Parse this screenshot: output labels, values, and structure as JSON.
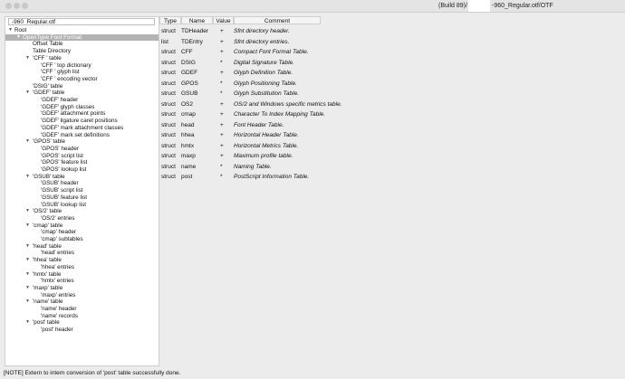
{
  "titlebar": {
    "build": "(Build 89)/",
    "path": "-960_Regular.otf/OTF"
  },
  "file_field": "-960_Regular.otf",
  "tree": [
    {
      "label": "Root",
      "arrow": "▼",
      "indent": 0
    },
    {
      "label": "OpenType Font Format",
      "arrow": "▼",
      "indent": 1,
      "selected": true
    },
    {
      "label": "Offset Table",
      "indent": 2
    },
    {
      "label": "Table Directory",
      "indent": 2
    },
    {
      "label": "'CFF ' table",
      "arrow": "▼",
      "indent": 2
    },
    {
      "label": "'CFF ' top dictionary",
      "indent": 3
    },
    {
      "label": "'CFF ' glyph list",
      "indent": 3
    },
    {
      "label": "'CFF ' encoding vector",
      "indent": 3
    },
    {
      "label": "'DSIG' table",
      "indent": 2
    },
    {
      "label": "'GDEF' table",
      "arrow": "▼",
      "indent": 2
    },
    {
      "label": "'GDEF' header",
      "indent": 3
    },
    {
      "label": "'GDEF' glyph classes",
      "indent": 3
    },
    {
      "label": "'GDEF' attachment points",
      "indent": 3
    },
    {
      "label": "'GDEF' ligature caret positions",
      "indent": 3
    },
    {
      "label": "'GDEF' mark attachment classes",
      "indent": 3
    },
    {
      "label": "'GDEF' mark set definitions",
      "indent": 3
    },
    {
      "label": "'GPOS' table",
      "arrow": "▼",
      "indent": 2
    },
    {
      "label": "'GPOS' header",
      "indent": 3
    },
    {
      "label": "'GPOS' script list",
      "indent": 3
    },
    {
      "label": "'GPOS' feature list",
      "indent": 3
    },
    {
      "label": "'GPOS' lookup list",
      "indent": 3
    },
    {
      "label": "'GSUB' table",
      "arrow": "▼",
      "indent": 2
    },
    {
      "label": "'GSUB' header",
      "indent": 3
    },
    {
      "label": "'GSUB' script list",
      "indent": 3
    },
    {
      "label": "'GSUB' feature list",
      "indent": 3
    },
    {
      "label": "'GSUB' lookup list",
      "indent": 3
    },
    {
      "label": "'OS/2' table",
      "arrow": "▼",
      "indent": 2
    },
    {
      "label": "'OS/2' entries",
      "indent": 3
    },
    {
      "label": "'cmap' table",
      "arrow": "▼",
      "indent": 2
    },
    {
      "label": "'cmap' header",
      "indent": 3
    },
    {
      "label": "'cmap' subtables",
      "indent": 3
    },
    {
      "label": "'head' table",
      "arrow": "▼",
      "indent": 2
    },
    {
      "label": "'head' entries",
      "indent": 3
    },
    {
      "label": "'hhea' table",
      "arrow": "▼",
      "indent": 2
    },
    {
      "label": "'hhea' entries",
      "indent": 3
    },
    {
      "label": "'hmtx' table",
      "arrow": "▼",
      "indent": 2
    },
    {
      "label": "'hmtx' entries",
      "indent": 3
    },
    {
      "label": "'maxp' table",
      "arrow": "▼",
      "indent": 2
    },
    {
      "label": "'maxp' entries",
      "indent": 3
    },
    {
      "label": "'name' table",
      "arrow": "▼",
      "indent": 2
    },
    {
      "label": "'name' header",
      "indent": 3
    },
    {
      "label": "'name' records",
      "indent": 3
    },
    {
      "label": "'post' table",
      "arrow": "▼",
      "indent": 2
    },
    {
      "label": "'post' header",
      "indent": 3
    }
  ],
  "table": {
    "headers": {
      "type": "Type",
      "name": "Name",
      "value": "Value",
      "comment": "Comment"
    },
    "rows": [
      {
        "type": "struct",
        "name": "TDHeader",
        "value": "+",
        "comment": "Sfnt directory header."
      },
      {
        "type": "list",
        "name": "TDEntry",
        "value": "+",
        "comment": "Sfnt directory entries."
      },
      {
        "type": "struct",
        "name": "CFF",
        "value": "+",
        "comment": "Compact Font Format Table."
      },
      {
        "type": "struct",
        "name": "DSIG",
        "value": "*",
        "comment": "Digital Signature Table."
      },
      {
        "type": "struct",
        "name": "GDEF",
        "value": "+",
        "comment": "Glyph Definition Table."
      },
      {
        "type": "struct",
        "name": "GPOS",
        "value": "*",
        "comment": "Glyph Positioning Table."
      },
      {
        "type": "struct",
        "name": "GSUB",
        "value": "*",
        "comment": "Glyph Substitution Table."
      },
      {
        "type": "struct",
        "name": "OS2",
        "value": "+",
        "comment": "OS/2 and Windows specific metrics table."
      },
      {
        "type": "struct",
        "name": "cmap",
        "value": "+",
        "comment": "Character To Index Mapping Table."
      },
      {
        "type": "struct",
        "name": "head",
        "value": "+",
        "comment": "Font Header Table."
      },
      {
        "type": "struct",
        "name": "hhea",
        "value": "+",
        "comment": "Horizontal Header Table."
      },
      {
        "type": "struct",
        "name": "hmtx",
        "value": "+",
        "comment": "Horizontal Metrics Table."
      },
      {
        "type": "struct",
        "name": "maxp",
        "value": "+",
        "comment": "Maximum profile table."
      },
      {
        "type": "struct",
        "name": "name",
        "value": "*",
        "comment": "Naming Table."
      },
      {
        "type": "struct",
        "name": "post",
        "value": "*",
        "comment": "PostScript Information Table."
      }
    ]
  },
  "status": "[NOTE] Extern to intern conversion of 'post' table successfully done."
}
